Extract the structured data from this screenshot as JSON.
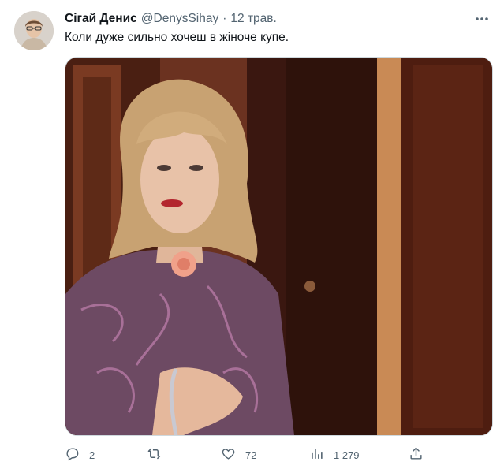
{
  "tweet": {
    "author_name": "Сігай Денис",
    "handle": "@DenysSihay",
    "separator": "·",
    "date": "12 трав.",
    "text": "Коли дуже сильно хочеш в жіноче купе.",
    "media_description_icon": "image",
    "actions": {
      "reply_count": "2",
      "retweet_count": "",
      "like_count": "72",
      "views_count": "1 279"
    },
    "icons": {
      "more": "more-icon",
      "reply": "reply-icon",
      "retweet": "retweet-icon",
      "like": "like-icon",
      "views": "views-icon",
      "share": "share-icon"
    },
    "colors": {
      "text_primary": "#0f1419",
      "text_secondary": "#536471",
      "border": "#cfd9de"
    }
  }
}
